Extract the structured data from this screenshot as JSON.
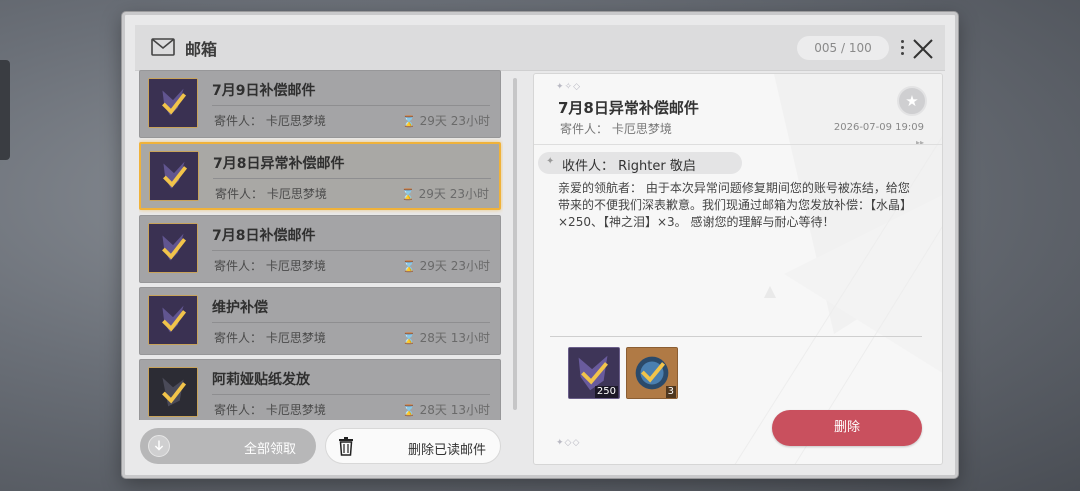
{
  "header": {
    "title": "邮箱",
    "counter": "005 / 100"
  },
  "mails": [
    {
      "subject": "7月9日补偿邮件",
      "sender": "寄件人：  卡厄思梦境",
      "expire": "29天 23小时",
      "selected": false
    },
    {
      "subject": "7月8日异常补偿邮件",
      "sender": "寄件人：  卡厄思梦境",
      "expire": "29天 23小时",
      "selected": true
    },
    {
      "subject": "7月8日补偿邮件",
      "sender": "寄件人：  卡厄思梦境",
      "expire": "29天 23小时",
      "selected": false
    },
    {
      "subject": "维护补偿",
      "sender": "寄件人：  卡厄思梦境",
      "expire": "28天 13小时",
      "selected": false
    },
    {
      "subject": "阿莉娅贴纸发放",
      "sender": "寄件人：  卡厄思梦境",
      "expire": "28天 13小时",
      "selected": false
    }
  ],
  "actions": {
    "collect_all": "全部领取",
    "delete_read": "删除已读邮件",
    "delete": "删除"
  },
  "detail": {
    "title": "7月8日异常补偿邮件",
    "sender": "寄件人：  卡厄思梦境",
    "date": "2026-07-09 19:09",
    "recipient": "收件人：  Righter 敬启",
    "body": "亲爱的领航者：  由于本次异常问题修复期间您的账号被冻结，给您带来的不便我们深表歉意。我们现通过邮箱为您发放补偿：【水晶】×250、【神之泪】×3。 感谢您的理解与耐心等待！",
    "rewards": [
      {
        "icon": "crystal-icon",
        "qty": "250"
      },
      {
        "icon": "tear-of-god-icon",
        "qty": "3"
      }
    ]
  },
  "colors": {
    "accent_selected": "#f0b23a",
    "delete_button": "#c9505e"
  }
}
